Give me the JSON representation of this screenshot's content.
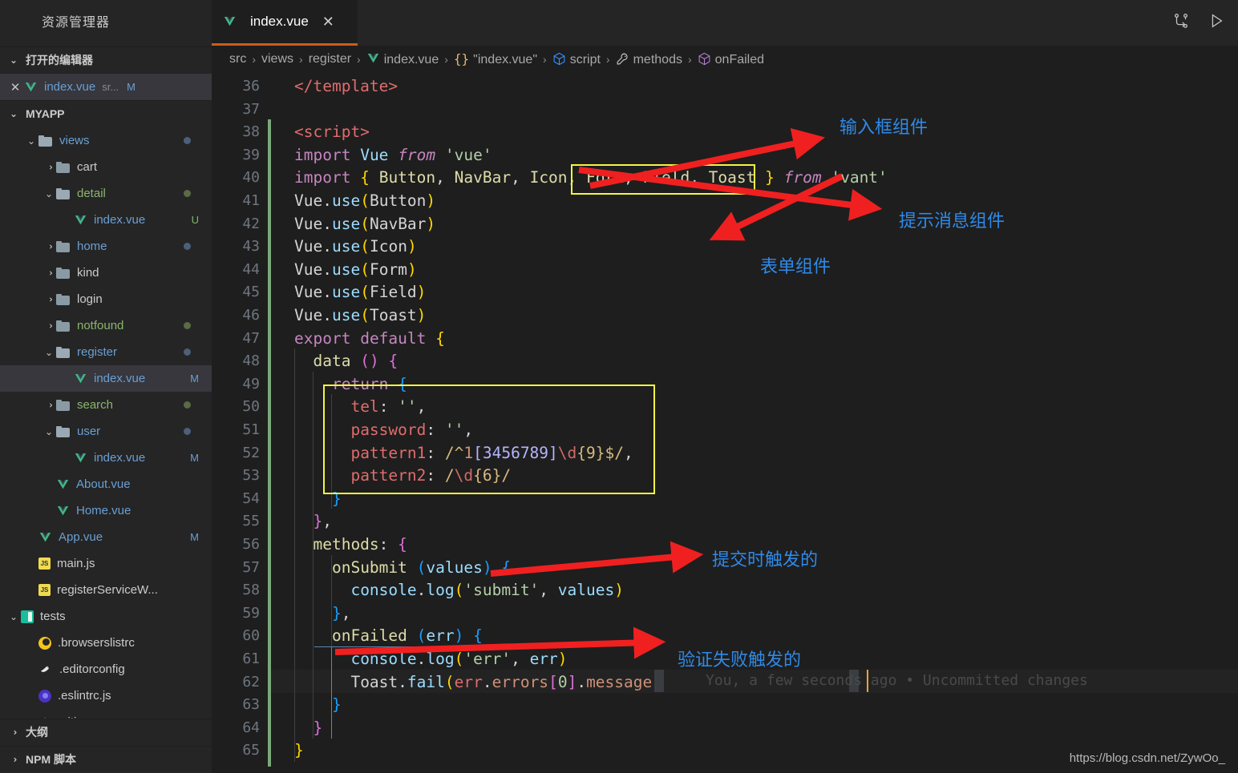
{
  "sidebar": {
    "title": "资源管理器",
    "open_editors": {
      "label": "打开的编辑器",
      "items": [
        {
          "name": "index.vue",
          "detail": "sr...",
          "badge": "M",
          "icon": "vue-file-icon"
        }
      ]
    },
    "project": {
      "label": "MYAPP",
      "items": [
        {
          "label": "views",
          "kind": "folder-open",
          "indent": 1,
          "icon": "views-folder-icon",
          "badge": "",
          "dot": "blue"
        },
        {
          "label": "cart",
          "kind": "folder",
          "indent": 2,
          "icon": "folder-icon",
          "badge": "",
          "dot": ""
        },
        {
          "label": "detail",
          "kind": "folder-open",
          "indent": 2,
          "icon": "folder-open-icon",
          "badge": "",
          "dot": "green"
        },
        {
          "label": "index.vue",
          "kind": "file-vue",
          "indent": 3,
          "icon": "vue-file-icon",
          "badge": "U",
          "dot": ""
        },
        {
          "label": "home",
          "kind": "folder",
          "indent": 2,
          "icon": "folder-icon",
          "badge": "",
          "dot": "blue"
        },
        {
          "label": "kind",
          "kind": "folder",
          "indent": 2,
          "icon": "folder-icon",
          "badge": "",
          "dot": ""
        },
        {
          "label": "login",
          "kind": "folder",
          "indent": 2,
          "icon": "folder-icon",
          "badge": "",
          "dot": ""
        },
        {
          "label": "notfound",
          "kind": "folder",
          "indent": 2,
          "icon": "folder-icon",
          "badge": "",
          "dot": "green"
        },
        {
          "label": "register",
          "kind": "folder-open",
          "indent": 2,
          "icon": "folder-open-icon",
          "badge": "",
          "dot": "blue"
        },
        {
          "label": "index.vue",
          "kind": "file-vue",
          "indent": 3,
          "icon": "vue-file-icon",
          "badge": "M",
          "dot": "",
          "selected": true
        },
        {
          "label": "search",
          "kind": "folder",
          "indent": 2,
          "icon": "folder-icon",
          "badge": "",
          "dot": "green"
        },
        {
          "label": "user",
          "kind": "folder-open",
          "indent": 2,
          "icon": "folder-open-icon",
          "badge": "",
          "dot": "blue"
        },
        {
          "label": "index.vue",
          "kind": "file-vue",
          "indent": 3,
          "icon": "vue-file-icon",
          "badge": "M",
          "dot": ""
        },
        {
          "label": "About.vue",
          "kind": "file-vue",
          "indent": 2,
          "icon": "vue-file-icon",
          "badge": "",
          "dot": ""
        },
        {
          "label": "Home.vue",
          "kind": "file-vue",
          "indent": 2,
          "icon": "vue-file-icon",
          "badge": "",
          "dot": ""
        },
        {
          "label": "App.vue",
          "kind": "file-vue",
          "indent": 1,
          "icon": "vue-file-icon",
          "badge": "M",
          "dot": ""
        },
        {
          "label": "main.js",
          "kind": "file-js",
          "indent": 1,
          "icon": "js-file-icon",
          "badge": "",
          "dot": ""
        },
        {
          "label": "registerServiceW...",
          "kind": "file-js",
          "indent": 1,
          "icon": "js-file-icon",
          "badge": "",
          "dot": ""
        },
        {
          "label": "tests",
          "kind": "folder-tests",
          "indent": 0,
          "icon": "tests-folder-icon",
          "badge": "",
          "dot": ""
        },
        {
          "label": ".browserslistrc",
          "kind": "file-brow",
          "indent": 1,
          "icon": "browserslist-icon",
          "badge": "",
          "dot": ""
        },
        {
          "label": ".editorconfig",
          "kind": "file-edc",
          "indent": 1,
          "icon": "editorconfig-icon",
          "badge": "",
          "dot": ""
        },
        {
          "label": ".eslintrc.js",
          "kind": "file-eslint",
          "indent": 1,
          "icon": "eslint-icon",
          "badge": "",
          "dot": ""
        },
        {
          "label": ".gitignore",
          "kind": "file-git",
          "indent": 1,
          "icon": "git-icon",
          "badge": "",
          "dot": ""
        }
      ]
    },
    "bottom_sections": [
      {
        "label": "大纲"
      },
      {
        "label": "NPM 脚本"
      }
    ]
  },
  "tabs": [
    {
      "label": "index.vue",
      "icon": "vue-file-icon",
      "close": "✕",
      "active": true
    }
  ],
  "toolbar": {
    "split_icon": "compare-changes-icon",
    "run_icon": "play-icon"
  },
  "breadcrumb": [
    {
      "text": "src",
      "icon": ""
    },
    {
      "text": "views",
      "icon": ""
    },
    {
      "text": "register",
      "icon": ""
    },
    {
      "text": "index.vue",
      "icon": "vue-file-icon"
    },
    {
      "text": "\"index.vue\"",
      "icon": "object-braces-icon"
    },
    {
      "text": "script",
      "icon": "cube-blue-icon"
    },
    {
      "text": "methods",
      "icon": "wrench-icon"
    },
    {
      "text": "onFailed",
      "icon": "cube-purple-icon"
    }
  ],
  "breadcrumb_separator": "›",
  "editor": {
    "first_line": 36,
    "lines": [
      {
        "n": 36,
        "text": "</template>"
      },
      {
        "n": 37,
        "text": ""
      },
      {
        "n": 38,
        "text": "<script>"
      },
      {
        "n": 39,
        "text": "import Vue from 'vue'"
      },
      {
        "n": 40,
        "text": "import { Button, NavBar, Icon, Form, Field, Toast } from 'vant'"
      },
      {
        "n": 41,
        "text": "Vue.use(Button)"
      },
      {
        "n": 42,
        "text": "Vue.use(NavBar)"
      },
      {
        "n": 43,
        "text": "Vue.use(Icon)"
      },
      {
        "n": 44,
        "text": "Vue.use(Form)"
      },
      {
        "n": 45,
        "text": "Vue.use(Field)"
      },
      {
        "n": 46,
        "text": "Vue.use(Toast)"
      },
      {
        "n": 47,
        "text": "export default {"
      },
      {
        "n": 48,
        "text": "  data () {"
      },
      {
        "n": 49,
        "text": "    return {"
      },
      {
        "n": 50,
        "text": "      tel: '',"
      },
      {
        "n": 51,
        "text": "      password: '',"
      },
      {
        "n": 52,
        "text": "      pattern1: /^1[3456789]\\d{9}$/,"
      },
      {
        "n": 53,
        "text": "      pattern2: /\\d{6}/"
      },
      {
        "n": 54,
        "text": "    }"
      },
      {
        "n": 55,
        "text": "  },"
      },
      {
        "n": 56,
        "text": "  methods: {"
      },
      {
        "n": 57,
        "text": "    onSubmit (values) {"
      },
      {
        "n": 58,
        "text": "      console.log('submit', values)"
      },
      {
        "n": 59,
        "text": "    },"
      },
      {
        "n": 60,
        "text": "    onFailed (err) {"
      },
      {
        "n": 61,
        "text": "      console.log('err', err)"
      },
      {
        "n": 62,
        "text": "      Toast.fail(err.errors[0].message)"
      },
      {
        "n": 63,
        "text": "    }"
      },
      {
        "n": 64,
        "text": "  }"
      },
      {
        "n": 65,
        "text": "}"
      }
    ],
    "blame": "You, a few seconds ago • Uncommitted changes",
    "blame_line": 62
  },
  "annotations": [
    {
      "id": "input-field-component",
      "text": "输入框组件"
    },
    {
      "id": "toast-message-component",
      "text": "提示消息组件"
    },
    {
      "id": "form-component",
      "text": "表单组件"
    },
    {
      "id": "on-submit-trigger",
      "text": "提交时触发的"
    },
    {
      "id": "on-failed-trigger",
      "text": "验证失败触发的"
    }
  ],
  "watermark": "https://blog.csdn.net/ZywOo_",
  "colors": {
    "accent_tab": "#cf5a1a",
    "annotation_text": "#2f8ae8",
    "annotation_arrow": "#f02020",
    "annotation_box": "#f5f542",
    "sidebar_bg": "#252526",
    "editor_bg": "#1e1e1e"
  }
}
